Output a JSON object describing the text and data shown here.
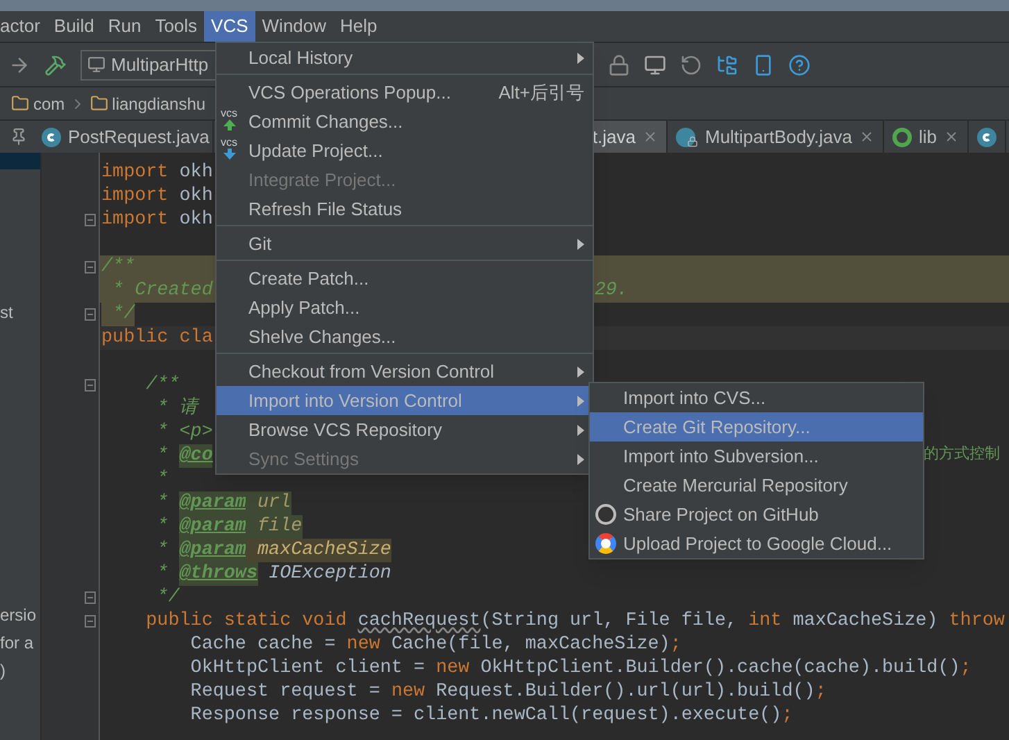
{
  "menubar": [
    {
      "label": "actor",
      "selected": false
    },
    {
      "label": "Build",
      "selected": false
    },
    {
      "label": "Run",
      "selected": false
    },
    {
      "label": "Tools",
      "selected": false
    },
    {
      "label": "VCS",
      "selected": true
    },
    {
      "label": "Window",
      "selected": false
    },
    {
      "label": "Help",
      "selected": false
    }
  ],
  "toolbar": {
    "run_config": "MultiparHttp"
  },
  "breadcrumb": [
    "com",
    "liangdianshu"
  ],
  "tabs": [
    {
      "label": "PostRequest.java",
      "kind": "class",
      "closable": false,
      "selected": false
    },
    {
      "label": "t.java",
      "kind": "none",
      "closable": true,
      "selected": true
    },
    {
      "label": "MultipartBody.java",
      "kind": "locked",
      "closable": true,
      "selected": false
    },
    {
      "label": "lib",
      "kind": "ring",
      "closable": true,
      "selected": false
    },
    {
      "kind": "class",
      "closable": false,
      "selected": false
    }
  ],
  "side_panel": {
    "upper": [
      "st"
    ],
    "lower": [
      "ersio",
      "for a",
      ")"
    ]
  },
  "code": [
    {
      "kind": "plain",
      "tokens": [
        {
          "kind": "kw",
          "text": "import "
        },
        {
          "kind": "txt",
          "text": "okh"
        }
      ]
    },
    {
      "kind": "plain",
      "tokens": [
        {
          "kind": "kw",
          "text": "import "
        },
        {
          "kind": "txt",
          "text": "okh"
        }
      ]
    },
    {
      "kind": "plain",
      "fold": true,
      "tokens": [
        {
          "kind": "kw",
          "text": "import "
        },
        {
          "kind": "txt",
          "text": "okh"
        }
      ]
    },
    {
      "kind": "plain"
    },
    {
      "kind": "doc-highlight",
      "fold": true,
      "tokens": [
        {
          "kind": "doc",
          "text": "/**"
        }
      ]
    },
    {
      "kind": "doc-highlight",
      "tokens": [
        {
          "kind": "doc",
          "text": " * Created"
        }
      ],
      "tail": {
        "kind": "past-menu",
        "tokens": [
          {
            "kind": "doc",
            "text": "29."
          }
        ]
      }
    },
    {
      "kind": "doc-end",
      "fold": true,
      "tokens": [
        {
          "kind": "doc",
          "text": " */"
        }
      ]
    },
    {
      "kind": "caret",
      "tokens": [
        {
          "kind": "kw",
          "text": "public cla"
        }
      ]
    },
    {
      "kind": "plain"
    },
    {
      "kind": "plain",
      "fold": true,
      "tokens": [
        {
          "kind": "doc",
          "text": "    /**"
        }
      ]
    },
    {
      "kind": "plain",
      "tokens": [
        {
          "kind": "doc",
          "text": "     * 请"
        }
      ]
    },
    {
      "kind": "plain",
      "tokens": [
        {
          "kind": "doc",
          "text": "     * <p>"
        }
      ]
    },
    {
      "kind": "plain",
      "tokens": [
        {
          "kind": "doc",
          "text": "     * "
        },
        {
          "kind": "tag",
          "text": "@co"
        }
      ],
      "tail": {
        "kind": "past-submenu",
        "tokens": [
          {
            "kind": "doc-cjk",
            "text": "的方式控制"
          }
        ]
      }
    },
    {
      "kind": "plain",
      "tokens": [
        {
          "kind": "doc",
          "text": "     *"
        }
      ]
    },
    {
      "kind": "plain",
      "tokens": [
        {
          "kind": "doc",
          "text": "     * "
        },
        {
          "kind": "tag",
          "text": "@param"
        },
        {
          "kind": "val",
          "text": " url"
        }
      ]
    },
    {
      "kind": "plain",
      "tokens": [
        {
          "kind": "doc",
          "text": "     * "
        },
        {
          "kind": "tag",
          "text": "@param"
        },
        {
          "kind": "val",
          "text": " file"
        }
      ]
    },
    {
      "kind": "plain",
      "tokens": [
        {
          "kind": "doc",
          "text": "     * "
        },
        {
          "kind": "tag",
          "text": "@param"
        },
        {
          "kind": "hl",
          "text": " maxCacheSize"
        }
      ]
    },
    {
      "kind": "plain",
      "tokens": [
        {
          "kind": "doc",
          "text": "     * "
        },
        {
          "kind": "tag",
          "text": "@throws"
        },
        {
          "kind": "docit",
          "text": " IOException"
        }
      ]
    },
    {
      "kind": "plain",
      "fold": true,
      "tokens": [
        {
          "kind": "doc",
          "text": "     */"
        }
      ]
    },
    {
      "kind": "plain",
      "fold": true,
      "tokens": [
        {
          "kind": "kw",
          "text": "    public static void "
        },
        {
          "kind": "warn",
          "text": "cachRequest"
        },
        {
          "kind": "txt",
          "text": "(String url, File file, "
        },
        {
          "kind": "kw",
          "text": "int "
        },
        {
          "kind": "txt",
          "text": "maxCacheSize) "
        },
        {
          "kind": "kw",
          "text": "throw"
        }
      ]
    },
    {
      "kind": "plain",
      "tokens": [
        {
          "kind": "txt",
          "text": "        Cache cache = "
        },
        {
          "kind": "kw",
          "text": "new "
        },
        {
          "kind": "txt",
          "text": "Cache(file, maxCacheSize)"
        },
        {
          "kind": "kw",
          "text": ";"
        }
      ]
    },
    {
      "kind": "plain",
      "tokens": [
        {
          "kind": "txt",
          "text": "        OkHttpClient client = "
        },
        {
          "kind": "kw",
          "text": "new "
        },
        {
          "kind": "txt",
          "text": "OkHttpClient.Builder().cache(cache).build()"
        },
        {
          "kind": "kw",
          "text": ";"
        }
      ]
    },
    {
      "kind": "plain",
      "tokens": [
        {
          "kind": "txt",
          "text": "        Request request = "
        },
        {
          "kind": "kw",
          "text": "new "
        },
        {
          "kind": "txt",
          "text": "Request.Builder().url(url).build()"
        },
        {
          "kind": "kw",
          "text": ";"
        }
      ]
    },
    {
      "kind": "plain",
      "tokens": [
        {
          "kind": "txt",
          "text": "        Response response = client.newCall(request).execute()"
        },
        {
          "kind": "kw",
          "text": ";"
        }
      ]
    }
  ],
  "vcs_menu": [
    {
      "kind": "item",
      "label": "Local History",
      "submenu": true,
      "disabled": false,
      "selected": false
    },
    {
      "kind": "separator"
    },
    {
      "kind": "item",
      "label": "VCS Operations Popup...",
      "shortcut": "Alt+后引号",
      "disabled": false,
      "selected": false
    },
    {
      "kind": "commit",
      "label": "Commit Changes...",
      "icon_label": "vcs",
      "disabled": false,
      "selected": false
    },
    {
      "kind": "update",
      "label": "Update Project...",
      "icon_label": "vcs",
      "disabled": false,
      "selected": false
    },
    {
      "kind": "item",
      "label": "Integrate Project...",
      "disabled": true,
      "selected": false
    },
    {
      "kind": "item",
      "label": "Refresh File Status",
      "disabled": false,
      "selected": false
    },
    {
      "kind": "separator"
    },
    {
      "kind": "item",
      "label": "Git",
      "submenu": true,
      "disabled": false,
      "selected": false
    },
    {
      "kind": "separator"
    },
    {
      "kind": "item",
      "label": "Create Patch...",
      "disabled": false,
      "selected": false
    },
    {
      "kind": "item",
      "label": "Apply Patch...",
      "disabled": false,
      "selected": false
    },
    {
      "kind": "item",
      "label": "Shelve Changes...",
      "disabled": false,
      "selected": false
    },
    {
      "kind": "separator"
    },
    {
      "kind": "item",
      "label": "Checkout from Version Control",
      "submenu": true,
      "disabled": false,
      "selected": false
    },
    {
      "kind": "item",
      "label": "Import into Version Control",
      "submenu": true,
      "disabled": false,
      "selected": true
    },
    {
      "kind": "item",
      "label": "Browse VCS Repository",
      "submenu": true,
      "disabled": false,
      "selected": false
    },
    {
      "kind": "item",
      "label": "Sync Settings",
      "submenu": true,
      "disabled": true,
      "selected": false
    }
  ],
  "import_submenu": [
    {
      "kind": "plain",
      "label": "Import into CVS...",
      "selected": false
    },
    {
      "kind": "plain",
      "label": "Create Git Repository...",
      "selected": true
    },
    {
      "kind": "plain",
      "label": "Import into Subversion...",
      "selected": false
    },
    {
      "kind": "plain",
      "label": "Create Mercurial Repository",
      "selected": false
    },
    {
      "kind": "github",
      "label": "Share Project on GitHub",
      "selected": false
    },
    {
      "kind": "cloud",
      "label": "Upload Project to Google Cloud...",
      "selected": false
    }
  ]
}
